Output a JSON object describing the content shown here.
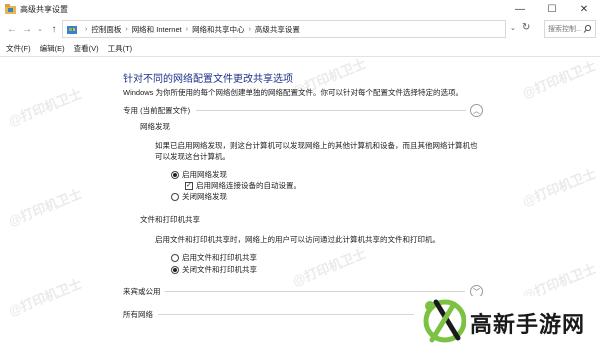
{
  "window": {
    "title": "高级共享设置",
    "minimize": "—",
    "maximize": "☐",
    "close": "✕"
  },
  "nav": {
    "back": "←",
    "forward": "→",
    "up": "↑",
    "breadcrumbs": [
      "控制面板",
      "网络和 Internet",
      "网络和共享中心",
      "高级共享设置"
    ],
    "search_placeholder": "搜索控制..."
  },
  "menu": [
    "文件(F)",
    "编辑(E)",
    "查看(V)",
    "工具(T)"
  ],
  "main": {
    "title": "针对不同的网络配置文件更改共享选项",
    "description": "Windows 为你所使用的每个网络创建单独的网络配置文件。你可以针对每个配置文件选择特定的选项。",
    "profiles": {
      "private": {
        "header": "专用 (当前配置文件)",
        "network_discovery": {
          "header": "网络发现",
          "text": "如果已启用网络发现，则这台计算机可以发现网络上的其他计算机和设备，而且其他网络计算机也可以发现这台计算机。",
          "opt_on": "启用网络发现",
          "opt_auto": "启用网络连接设备的自动设置。",
          "opt_off": "关闭网络发现"
        },
        "file_sharing": {
          "header": "文件和打印机共享",
          "text": "启用文件和打印机共享时，网络上的用户可以访问通过此计算机共享的文件和打印机。",
          "opt_on": "启用文件和打印机共享",
          "opt_off": "关闭文件和打印机共享"
        }
      },
      "guest": {
        "header": "来宾或公用"
      },
      "all": {
        "header": "所有网络"
      }
    }
  },
  "state": {
    "network_discovery_on": true,
    "auto_setup_checked": true,
    "file_sharing_on": false
  },
  "watermark": "@打印机卫士",
  "brand": {
    "name": "高新手游网"
  },
  "colors": {
    "title_blue": "#1e3287",
    "logo_green": "#7cc242",
    "logo_dark": "#1a1a1a"
  }
}
